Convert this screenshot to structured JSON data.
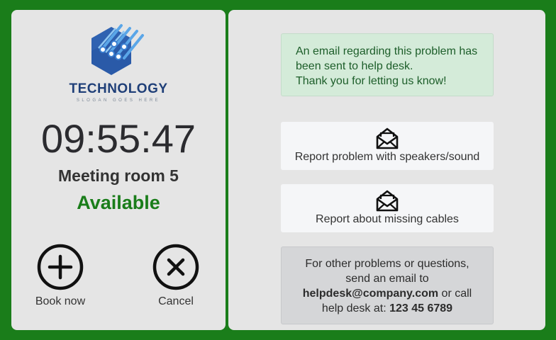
{
  "logo": {
    "title": "TECHNOLOGY",
    "slogan": "SLOGAN GOES HERE",
    "colors": [
      "#2a5aa8",
      "#3b7fd1",
      "#5aa6e8"
    ]
  },
  "clock": {
    "time": "09:55:47"
  },
  "room": {
    "name": "Meeting room 5",
    "status": "Available",
    "status_color": "#1a7d1a"
  },
  "actions": {
    "book": {
      "label": "Book now",
      "icon": "plus-circle-icon"
    },
    "cancel": {
      "label": "Cancel",
      "icon": "x-circle-icon"
    }
  },
  "notice": {
    "lines": [
      "An email regarding this problem has",
      "been sent to help desk.",
      "Thank you for letting us know!"
    ]
  },
  "reports": [
    {
      "label": "Report problem with speakers/sound",
      "icon": "envelope-open-icon"
    },
    {
      "label": "Report about missing cables",
      "icon": "envelope-open-icon"
    }
  ],
  "info": {
    "line1": "For other problems or questions,",
    "line2": "send an email to",
    "email": "helpdesk@company.com",
    "or_call": " or call",
    "line4_prefix": "help desk at: ",
    "phone": "123 45 6789"
  },
  "colors": {
    "background": "#1a7d1a",
    "panel": "#e5e5e5",
    "notice_bg": "#d4ebd9",
    "notice_text": "#1d5e2a"
  }
}
